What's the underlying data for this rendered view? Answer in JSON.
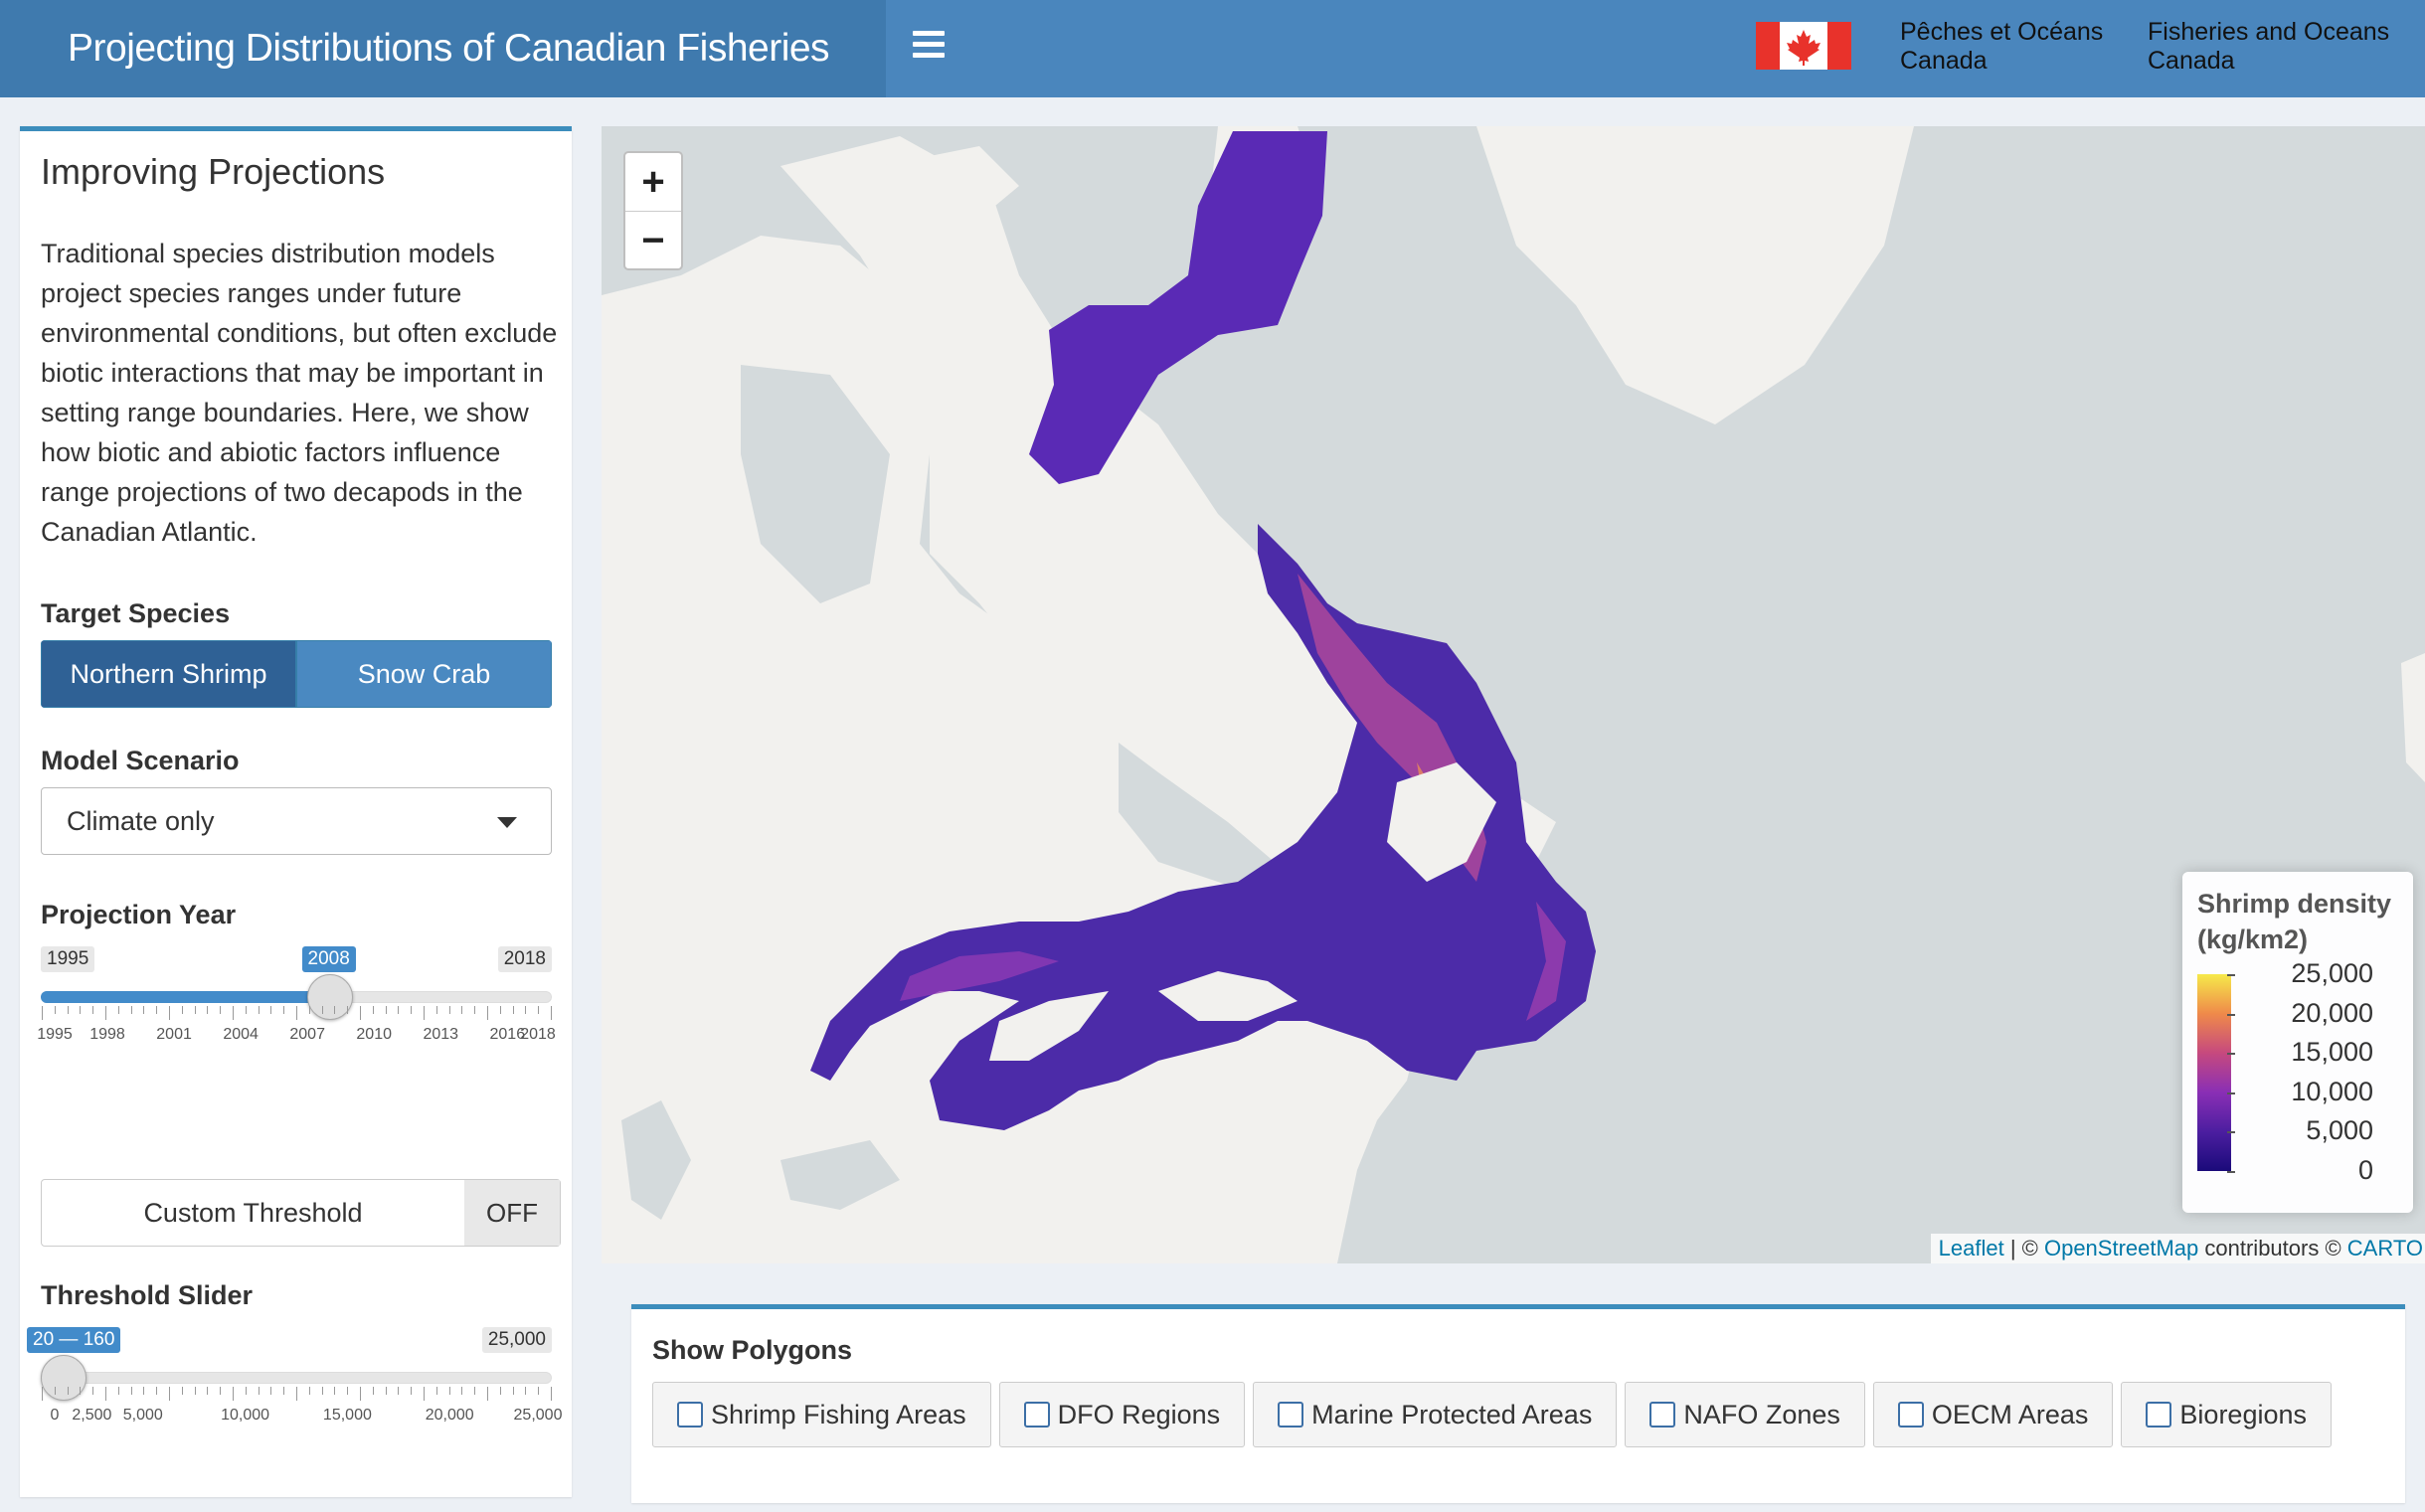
{
  "header": {
    "title": "Projecting Distributions of Canadian Fisheries",
    "dept_fr_line1": "Pêches et Océans",
    "dept_fr_line2": "Canada",
    "dept_en_line1": "Fisheries and Oceans",
    "dept_en_line2": "Canada",
    "accent_color": "#4a86bd"
  },
  "sidebar": {
    "title": "Improving Projections",
    "description": "Traditional species distribution models project species ranges under future environmental conditions, but often exclude biotic interactions that may be important in setting range boundaries. Here, we show how biotic and abiotic factors influence range projections of two decapods in the Canadian Atlantic.",
    "target_species_label": "Target Species",
    "species": [
      "Northern Shrimp",
      "Snow Crab"
    ],
    "selected_species": "Northern Shrimp",
    "model_scenario_label": "Model Scenario",
    "model_scenario_value": "Climate only",
    "projection_year_label": "Projection Year",
    "year_slider": {
      "min": 1995,
      "max": 2018,
      "value": 2008,
      "min_label": "1995",
      "max_label": "2018",
      "value_label": "2008",
      "ticks": [
        "1995",
        "1998",
        "2001",
        "2004",
        "2007",
        "2010",
        "2013",
        "2016",
        "2018"
      ]
    },
    "custom_threshold_label": "Custom Threshold",
    "custom_threshold_state": "OFF",
    "threshold_slider_label": "Threshold Slider",
    "threshold_slider": {
      "min": 0,
      "max": 25000,
      "low": 20,
      "high": 160,
      "value_label": "20 — 160",
      "max_label": "25,000",
      "ticks": [
        "0",
        "2,500",
        "5,000",
        "10,000",
        "15,000",
        "20,000",
        "25,000"
      ]
    }
  },
  "map": {
    "zoom_in": "+",
    "zoom_out": "−",
    "legend_title_line1": "Shrimp density",
    "legend_title_line2": "(kg/km2)",
    "legend_labels": [
      "25,000",
      "20,000",
      "15,000",
      "10,000",
      "5,000",
      "0"
    ],
    "attribution_leaflet": "Leaflet",
    "attribution_sep": " | © ",
    "attribution_osm": "OpenStreetMap",
    "attribution_contrib": " contributors © ",
    "attribution_carto": "CARTO"
  },
  "polygons": {
    "label": "Show Polygons",
    "items": [
      "Shrimp Fishing Areas",
      "DFO Regions",
      "Marine Protected Areas",
      "NAFO Zones",
      "OECM Areas",
      "Bioregions"
    ]
  }
}
